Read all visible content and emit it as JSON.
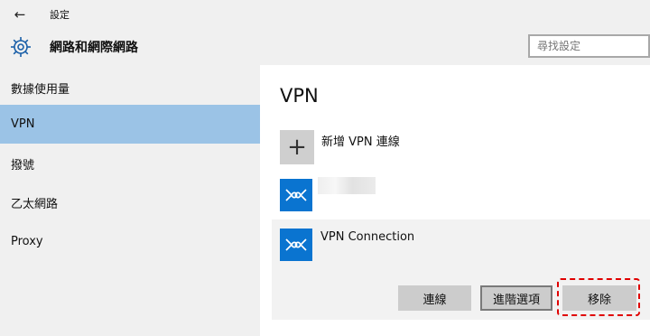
{
  "window": {
    "title": "設定"
  },
  "header": {
    "title": "網路和網際網路",
    "search_placeholder": "尋找設定"
  },
  "sidebar": {
    "items": [
      {
        "label": "數據使用量"
      },
      {
        "label": "VPN",
        "active": true
      },
      {
        "label": "撥號"
      },
      {
        "label": "乙太網路"
      },
      {
        "label": "Proxy"
      }
    ]
  },
  "main": {
    "heading": "VPN",
    "add_label": "新增 VPN 連線",
    "connections": [
      {
        "label": ""
      },
      {
        "label": "VPN Connection",
        "selected": true
      }
    ],
    "buttons": {
      "connect": "連線",
      "advanced": "進階選項",
      "remove": "移除"
    }
  },
  "colors": {
    "accent": "#0a74d0",
    "sidebar_active": "#9bc3e6",
    "chrome_bg": "#f0f0f0",
    "highlight": "#e00000"
  },
  "icons": [
    "back-arrow-icon",
    "gear-icon",
    "plus-icon",
    "vpn-icon"
  ]
}
